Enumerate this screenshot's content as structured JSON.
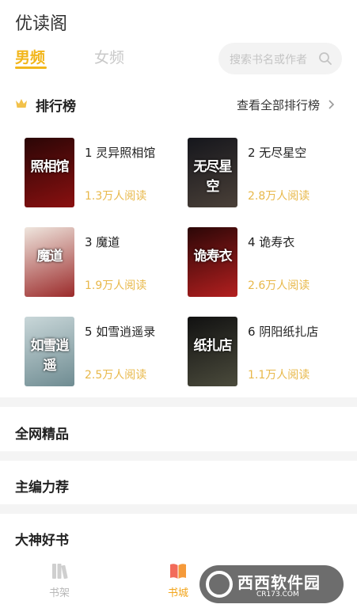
{
  "header": {
    "title": "优读阁"
  },
  "tabs": [
    {
      "label": "男频",
      "active": true
    },
    {
      "label": "女频",
      "active": false
    }
  ],
  "search": {
    "placeholder": "搜索书名或作者",
    "icon": "search-icon"
  },
  "ranking": {
    "title": "排行榜",
    "icon": "crown-icon",
    "view_all": "查看全部排行榜",
    "books": [
      {
        "rank_title": "1 灵异照相馆",
        "reads": "1.3万人阅读",
        "cover_text": "照相馆",
        "cover_colors": [
          "#2a0606",
          "#8a1010"
        ]
      },
      {
        "rank_title": "2 无尽星空",
        "reads": "2.8万人阅读",
        "cover_text": "无尽星空",
        "cover_colors": [
          "#15161c",
          "#4a4038"
        ]
      },
      {
        "rank_title": "3 魔道",
        "reads": "1.9万人阅读",
        "cover_text": "魔道",
        "cover_colors": [
          "#efe6de",
          "#9b2a2a"
        ]
      },
      {
        "rank_title": "4 诡寿衣",
        "reads": "2.6万人阅读",
        "cover_text": "诡寿衣",
        "cover_colors": [
          "#2b0707",
          "#b31f1f"
        ]
      },
      {
        "rank_title": "5 如雪逍遥录",
        "reads": "2.5万人阅读",
        "cover_text": "如雪逍遥",
        "cover_colors": [
          "#c9d7d9",
          "#6f8c92"
        ]
      },
      {
        "rank_title": "6 阴阳纸扎店",
        "reads": "1.1万人阅读",
        "cover_text": "纸扎店",
        "cover_colors": [
          "#111111",
          "#4b4b3c"
        ]
      }
    ]
  },
  "sections": [
    {
      "label": "全网精品"
    },
    {
      "label": "主编力荐"
    },
    {
      "label": "大神好书"
    }
  ],
  "bottom_nav": [
    {
      "label": "书架",
      "icon": "bookshelf-icon",
      "active": false
    },
    {
      "label": "书城",
      "icon": "bookstore-icon",
      "active": true
    }
  ],
  "watermark": {
    "brand": "西西软件园",
    "url": "CR173.COM"
  },
  "colors": {
    "accent": "#f2b61b",
    "reads": "#e8b84a"
  }
}
